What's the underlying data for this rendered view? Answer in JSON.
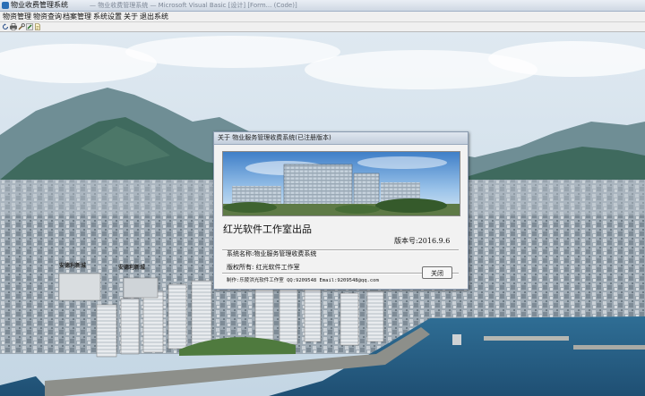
{
  "window": {
    "title": "物业收费管理系统",
    "ghost_text": "— 物业收费管理系统 — Microsoft Visual Basic [设计] [Form... (Code)]"
  },
  "menubar": {
    "items": [
      "物资管理",
      "物资查询",
      "档案管理",
      "系统设置",
      "关于",
      "退出系统"
    ]
  },
  "toolbar": {
    "icons": [
      "refresh-icon",
      "print-icon",
      "tools-icon",
      "edit-icon",
      "document-icon"
    ]
  },
  "background": {
    "labels": [
      "安德利新城",
      "安德利新城"
    ]
  },
  "about_dialog": {
    "title": "关于 物业服务管理收费系统(已注册版本)",
    "heading": "红光软件工作室出品",
    "version": "版本号:2016.9.6",
    "system_name": "系统名称:物业服务管理收费系统",
    "copyright": "版权所有: 红光软件工作室",
    "credit": "制作:乐陵洪光软件工作室 QQ:9209548 Email:9209548@qq.com",
    "close_label": "关闭"
  }
}
